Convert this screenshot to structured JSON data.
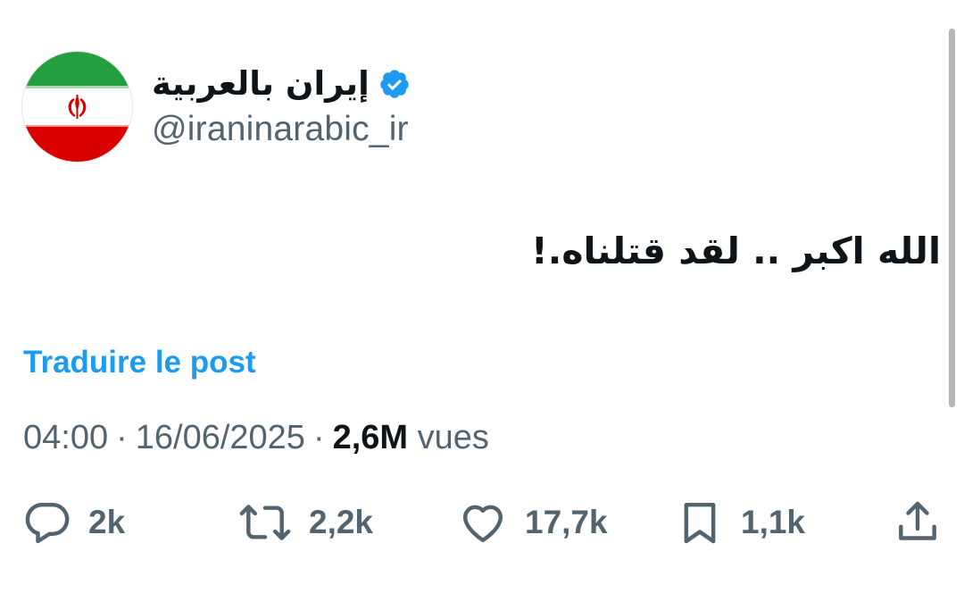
{
  "profile": {
    "display_name": "إيران بالعربية",
    "handle": "@iraninarabic_ir",
    "verified": true,
    "avatar_icon": "iran-flag-icon",
    "flag_colors": {
      "green": "#239f40",
      "white": "#ffffff",
      "red": "#da0000"
    }
  },
  "tweet": {
    "text": "الله اكبر .. لقد قتلناه.!",
    "translate_label": "Traduire le post"
  },
  "meta": {
    "time": "04:00",
    "date": "16/06/2025",
    "views_count": "2,6M",
    "views_label": "vues",
    "separator": "·"
  },
  "actions": {
    "reply": {
      "icon": "reply-icon",
      "count": "2k"
    },
    "repost": {
      "icon": "repost-icon",
      "count": "2,2k"
    },
    "like": {
      "icon": "heart-icon",
      "count": "17,7k"
    },
    "bookmark": {
      "icon": "bookmark-icon",
      "count": "1,1k"
    },
    "share": {
      "icon": "share-icon"
    }
  },
  "colors": {
    "accent": "#1d9bf0",
    "text_primary": "#0f1419",
    "text_secondary": "#536471"
  }
}
